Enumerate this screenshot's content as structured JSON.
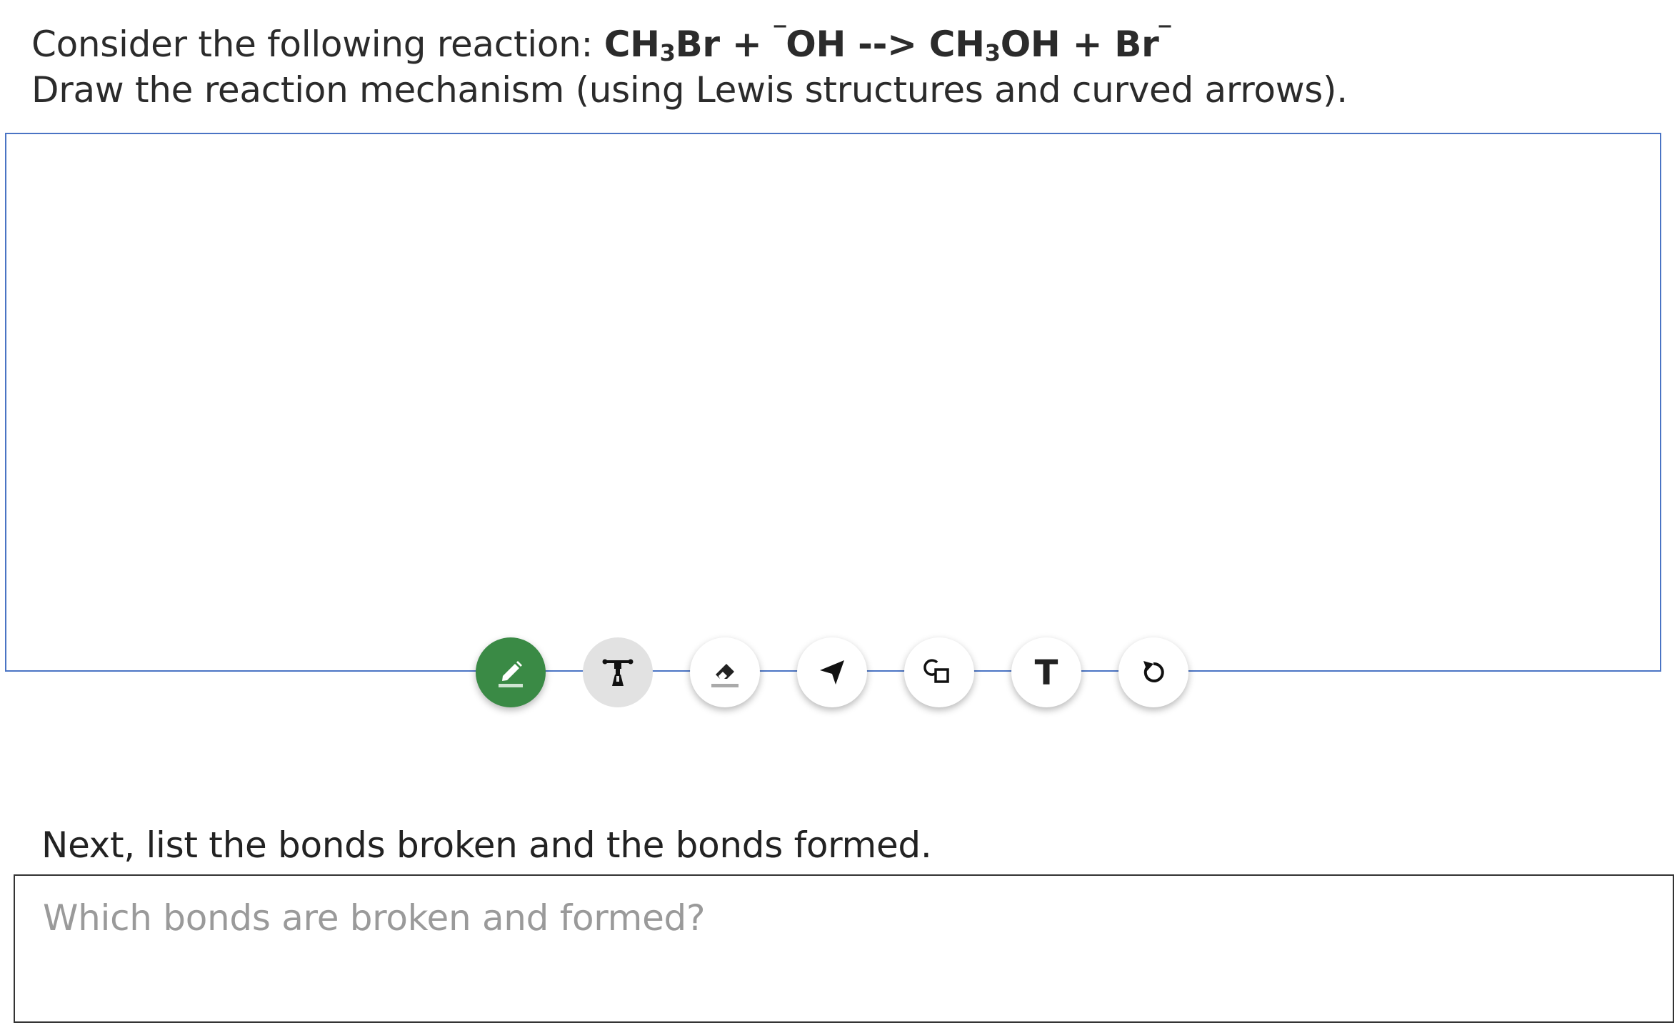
{
  "question": {
    "intro": "Consider the following reaction: ",
    "equation": {
      "r1_a": "CH",
      "r1_sub": "3",
      "r1_b": "Br",
      "plus1": " + ",
      "charge_oh": "‾",
      "oh": "OH",
      "arrow": " --> ",
      "p1_a": "CH",
      "p1_sub": "3",
      "p1_b": "OH",
      "plus2": " + ",
      "br": "Br",
      "charge_br": "‾"
    },
    "instruction": "Draw the reaction mechanism (using Lewis structures and curved arrows)."
  },
  "toolbar": {
    "tools": [
      {
        "icon": "pencil-icon",
        "state": "active"
      },
      {
        "icon": "lab-stand-icon",
        "state": "disabled"
      },
      {
        "icon": "eraser-icon",
        "state": "normal"
      },
      {
        "icon": "arrow-pointer-icon",
        "state": "normal"
      },
      {
        "icon": "shapes-icon",
        "state": "normal"
      },
      {
        "icon": "text-icon",
        "state": "normal"
      },
      {
        "icon": "undo-icon",
        "state": "normal"
      }
    ],
    "text_tool_glyph": "T",
    "active_color": "#3a8a45"
  },
  "part2": {
    "prompt": "Next, list the bonds broken and the bonds formed.",
    "placeholder": "Which bonds are broken and formed?",
    "value": ""
  },
  "colors": {
    "canvas_border": "#4a74c4",
    "answer_border": "#333333",
    "placeholder": "#9a9a9a"
  }
}
